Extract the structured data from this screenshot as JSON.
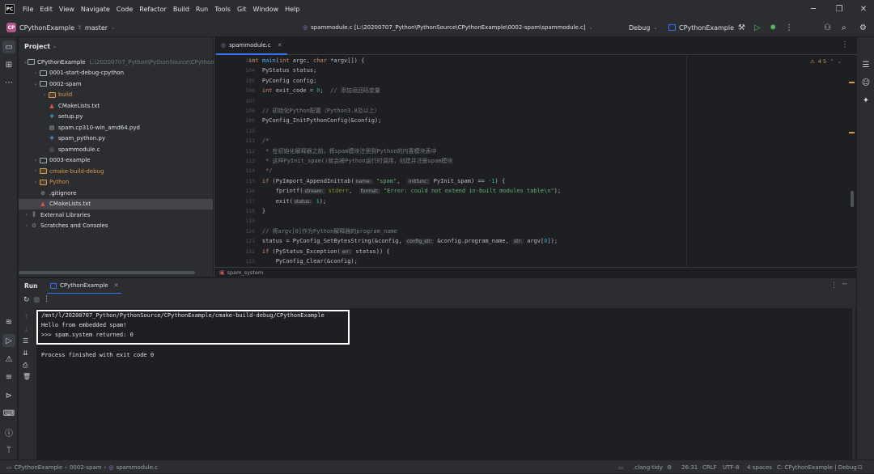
{
  "menu": [
    "File",
    "Edit",
    "View",
    "Navigate",
    "Code",
    "Refactor",
    "Build",
    "Run",
    "Tools",
    "Git",
    "Window",
    "Help"
  ],
  "toolbar": {
    "project_badge": "CP",
    "project_name": "CPythonExample",
    "branch": "master",
    "file_path": "spammodule.c [L:\\20200707_Python\\PythonSource\\CPythonExample\\0002-spam\\spammodule.c]",
    "build_mode": "Debug",
    "run_config": "CPythonExample"
  },
  "project": {
    "title": "Project",
    "rows": [
      {
        "label": "CPythonExample",
        "hint": "L:\\20200707_Python\\PythonSource\\CPythonExample",
        "indent": 0,
        "arrow": "v",
        "icon": "folder"
      },
      {
        "label": "0001-start-debug-cpython",
        "indent": 1,
        "arrow": ">",
        "icon": "folder"
      },
      {
        "label": "0002-spam",
        "indent": 1,
        "arrow": "v",
        "icon": "folder"
      },
      {
        "label": "build",
        "indent": 2,
        "arrow": ">",
        "icon": "folder-orange",
        "orange": true
      },
      {
        "label": "CMakeLists.txt",
        "indent": 2,
        "arrow": "",
        "icon": "cmake"
      },
      {
        "label": "setup.py",
        "indent": 2,
        "arrow": "",
        "icon": "python"
      },
      {
        "label": "spam.cp310-win_amd64.pyd",
        "indent": 2,
        "arrow": "",
        "icon": "file"
      },
      {
        "label": "spam_python.py",
        "indent": 2,
        "arrow": "",
        "icon": "python"
      },
      {
        "label": "spammodule.c",
        "indent": 2,
        "arrow": "",
        "icon": "c"
      },
      {
        "label": "0003-example",
        "indent": 1,
        "arrow": ">",
        "icon": "folder"
      },
      {
        "label": "cmake-build-debug",
        "indent": 1,
        "arrow": ">",
        "icon": "folder-orange",
        "orange": true
      },
      {
        "label": "Python",
        "indent": 1,
        "arrow": ">",
        "icon": "folder-orange",
        "orange": true
      },
      {
        "label": ".gitignore",
        "indent": 1,
        "arrow": "",
        "icon": "ignore"
      },
      {
        "label": "CMakeLists.txt",
        "indent": 1,
        "arrow": "",
        "icon": "cmake",
        "selected": true
      },
      {
        "label": "External Libraries",
        "indent": 0,
        "arrow": ">",
        "icon": "lib"
      },
      {
        "label": "Scratches and Consoles",
        "indent": 0,
        "arrow": ">",
        "icon": "scratch"
      }
    ]
  },
  "editor": {
    "tab_label": "spammodule.c",
    "inspections": "4  5",
    "breadcrumb": "spam_system",
    "line_numbers": [
      "103",
      "104",
      "105",
      "106",
      "107",
      "108",
      "109",
      "110",
      "111",
      "112",
      "113",
      "114",
      "115",
      "116",
      "117",
      "118",
      "119",
      "120",
      "121",
      "122",
      "123"
    ],
    "lines": [
      [
        {
          "t": "int ",
          "c": "kw"
        },
        {
          "t": "main",
          "c": "fn"
        },
        {
          "t": "(",
          "c": ""
        },
        {
          "t": "int ",
          "c": "kw"
        },
        {
          "t": "argc, ",
          "c": ""
        },
        {
          "t": "char ",
          "c": "kw"
        },
        {
          "t": "*argv[]) {",
          "c": ""
        }
      ],
      [
        {
          "t": "    PyStatus status;",
          "c": ""
        }
      ],
      [
        {
          "t": "    PyConfig config;",
          "c": ""
        }
      ],
      [
        {
          "t": "    ",
          "c": ""
        },
        {
          "t": "int ",
          "c": "kw"
        },
        {
          "t": "exit_code = ",
          "c": ""
        },
        {
          "t": "0",
          "c": "num"
        },
        {
          "t": ";  ",
          "c": ""
        },
        {
          "t": "// 添加返回码变量",
          "c": "cmt"
        }
      ],
      [
        {
          "t": "",
          "c": ""
        }
      ],
      [
        {
          "t": "    ",
          "c": ""
        },
        {
          "t": "// 初始化Python配置（Python3.8及以上）",
          "c": "cmt"
        }
      ],
      [
        {
          "t": "    PyConfig_InitPythonConfig(&config);",
          "c": ""
        }
      ],
      [
        {
          "t": "",
          "c": ""
        }
      ],
      [
        {
          "t": "    ",
          "c": ""
        },
        {
          "t": "/*",
          "c": "cmt"
        }
      ],
      [
        {
          "t": "     ",
          "c": ""
        },
        {
          "t": "* 在初始化解释器之前，将spam模块注册到Python的内置模块表中",
          "c": "cmt"
        }
      ],
      [
        {
          "t": "     ",
          "c": ""
        },
        {
          "t": "* 这样PyInit_spam()就会被Python运行时调用，创建并注册spam模块",
          "c": "cmt"
        }
      ],
      [
        {
          "t": "     ",
          "c": ""
        },
        {
          "t": "*/",
          "c": "cmt"
        }
      ],
      [
        {
          "t": "    ",
          "c": ""
        },
        {
          "t": "if ",
          "c": "kw"
        },
        {
          "t": "(PyImport_AppendInittab(",
          "c": ""
        },
        {
          "t": "name:",
          "c": "ph"
        },
        {
          "t": " ",
          "c": ""
        },
        {
          "t": "\"spam\"",
          "c": "str"
        },
        {
          "t": ",  ",
          "c": ""
        },
        {
          "t": "initfunc:",
          "c": "ph"
        },
        {
          "t": " PyInit_spam) == ",
          "c": ""
        },
        {
          "t": "-1",
          "c": "num"
        },
        {
          "t": ") {",
          "c": ""
        }
      ],
      [
        {
          "t": "        fprintf(",
          "c": ""
        },
        {
          "t": "stream:",
          "c": "ph"
        },
        {
          "t": " ",
          "c": ""
        },
        {
          "t": "stderr",
          "c": "mac"
        },
        {
          "t": ",  ",
          "c": ""
        },
        {
          "t": "format:",
          "c": "ph"
        },
        {
          "t": " ",
          "c": ""
        },
        {
          "t": "\"Error: could not extend in-built modules table\\n\"",
          "c": "str"
        },
        {
          "t": ");",
          "c": ""
        }
      ],
      [
        {
          "t": "        exit(",
          "c": ""
        },
        {
          "t": "status:",
          "c": "ph"
        },
        {
          "t": " ",
          "c": ""
        },
        {
          "t": "1",
          "c": "num"
        },
        {
          "t": ");",
          "c": ""
        }
      ],
      [
        {
          "t": "    }",
          "c": ""
        }
      ],
      [
        {
          "t": "",
          "c": ""
        }
      ],
      [
        {
          "t": "    ",
          "c": ""
        },
        {
          "t": "// 将argv[0]作为Python解释器的program_name",
          "c": "cmt"
        }
      ],
      [
        {
          "t": "    status = PyConfig_SetBytesString(&config, ",
          "c": ""
        },
        {
          "t": "config_str:",
          "c": "ph"
        },
        {
          "t": " &config.program_name, ",
          "c": ""
        },
        {
          "t": "str:",
          "c": "ph"
        },
        {
          "t": " argv[",
          "c": ""
        },
        {
          "t": "0",
          "c": "num"
        },
        {
          "t": "]);",
          "c": ""
        }
      ],
      [
        {
          "t": "    ",
          "c": ""
        },
        {
          "t": "if ",
          "c": "kw"
        },
        {
          "t": "(PyStatus_Exception(",
          "c": ""
        },
        {
          "t": "err:",
          "c": "ph"
        },
        {
          "t": " status)) {",
          "c": ""
        }
      ],
      [
        {
          "t": "        PyConfig_Clear(&config);",
          "c": ""
        }
      ]
    ]
  },
  "run": {
    "title": "Run",
    "tab_label": "CPythonExample",
    "output": [
      "/mnt/l/20200707_Python/PythonSource/CPythonExample/cmake-build-debug/CPythonExample",
      "Hello from embedded spam!",
      ">>> spam.system returned: 0",
      "",
      "Process finished with exit code 0"
    ]
  },
  "status": {
    "breadcrumb": [
      "CPythonExample",
      "0002-spam",
      "spammodule.c"
    ],
    "linter": ".clang-tidy",
    "position": "26:31",
    "line_sep": "CRLF",
    "encoding": "UTF-8",
    "indent": "4 spaces",
    "context": "C: CPythonExample | Debug"
  }
}
